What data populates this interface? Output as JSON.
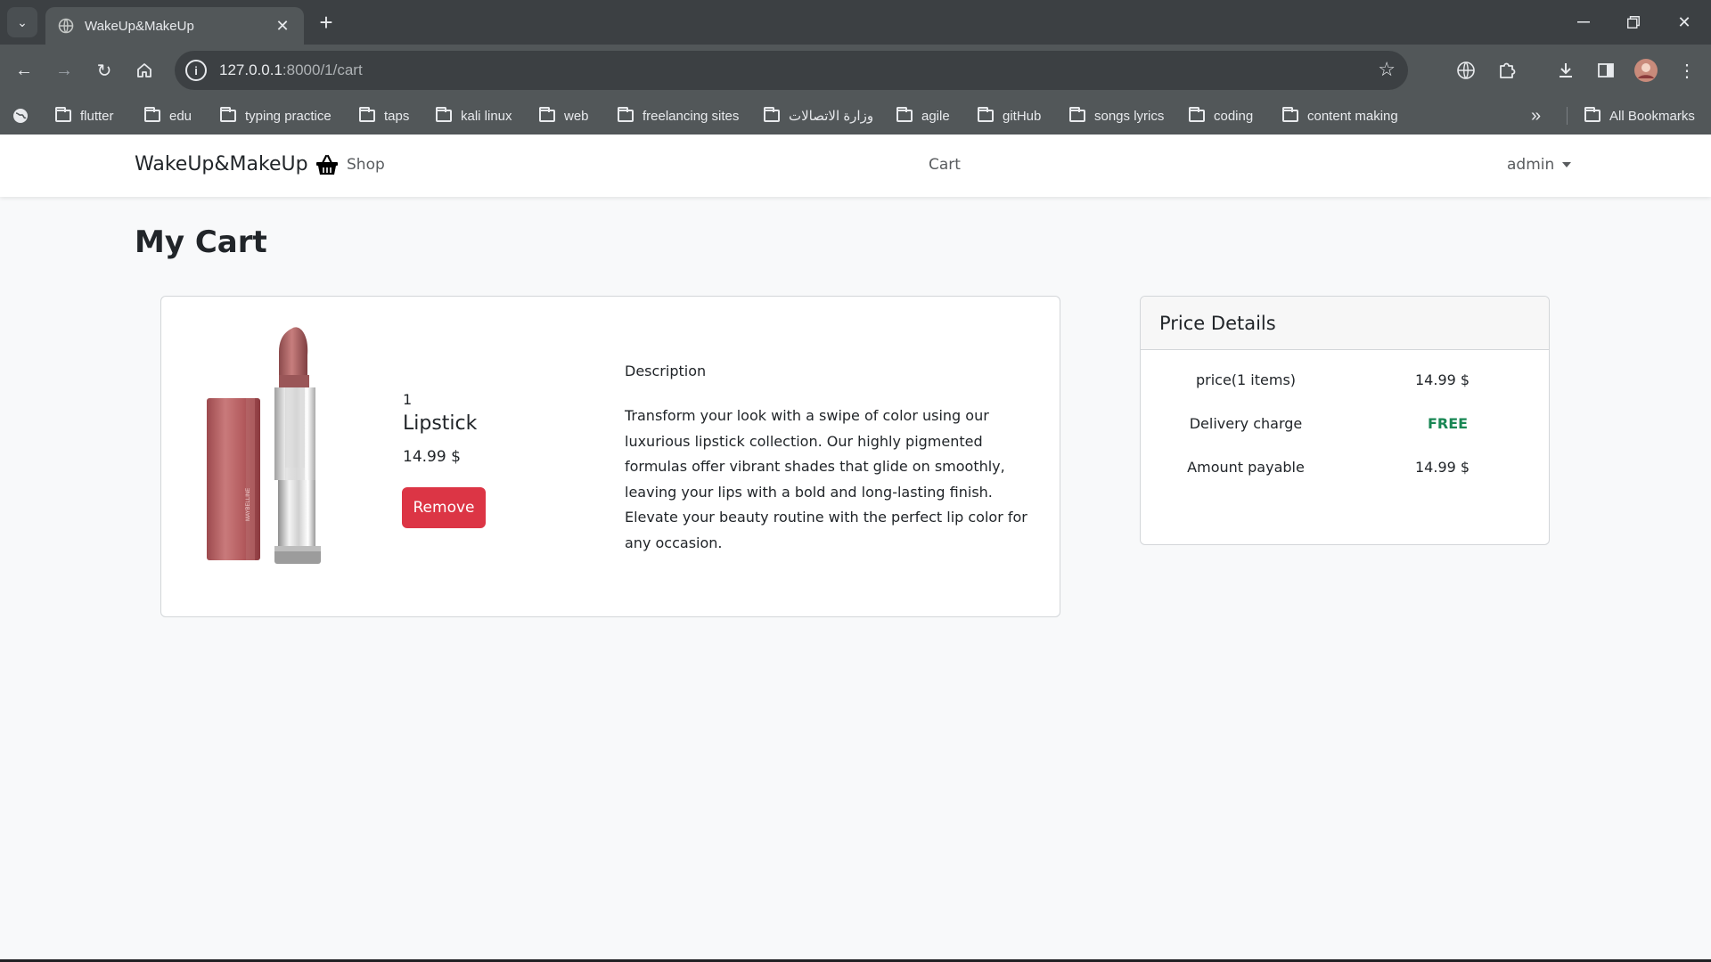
{
  "browser": {
    "tab_title": "WakeUp&MakeUp",
    "url_host": "127.0.0.1",
    "url_path": ":8000/1/cart",
    "bookmarks": [
      "flutter",
      "edu",
      "typing practice",
      "taps",
      "kali linux",
      "web",
      "freelancing sites",
      "وزارة الاتصالات",
      "agile",
      "gitHub",
      "songs lyrics",
      "coding",
      "content making"
    ],
    "all_bookmarks": "All Bookmarks"
  },
  "navbar": {
    "brand": "WakeUp&MakeUp",
    "shop": "Shop",
    "cart": "Cart",
    "user": "admin"
  },
  "page": {
    "title": "My Cart"
  },
  "cart_item": {
    "quantity": "1",
    "name": "Lipstick",
    "price": "14.99 $",
    "remove_label": "Remove",
    "description_title": "Description",
    "description": "Transform your look with a swipe of color using our luxurious lipstick collection. Our highly pigmented formulas offer vibrant shades that glide on smoothly, leaving your lips with a bold and long-lasting finish. Elevate your beauty routine with the perfect lip color for any occasion."
  },
  "price_details": {
    "title": "Price Details",
    "rows": [
      {
        "label": "price(1 items)",
        "value": "14.99 $"
      },
      {
        "label": "Delivery charge",
        "value": "FREE"
      },
      {
        "label": "Amount payable",
        "value": "14.99 $"
      }
    ]
  },
  "colors": {
    "remove_button": "#dc3545",
    "free_text": "#198754"
  }
}
